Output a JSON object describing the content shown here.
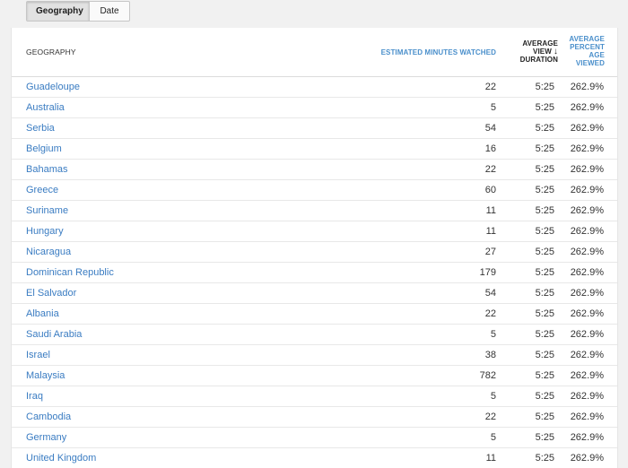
{
  "tabs": [
    {
      "label": "Geography",
      "active": true
    },
    {
      "label": "Date",
      "active": false
    }
  ],
  "table": {
    "headers": {
      "geography": "GEOGRAPHY",
      "estimated_minutes": "ESTIMATED MINUTES WATCHED",
      "avg_view_duration_line1": "AVERAGE",
      "avg_view_duration_line2": "VIEW",
      "avg_view_duration_line3": "DURATION",
      "sort_arrow": "↓",
      "avg_percent_line1": "AVERAGE",
      "avg_percent_line2": "PERCENT",
      "avg_percent_line3": "AGE",
      "avg_percent_line4": "VIEWED"
    },
    "rows": [
      {
        "geography": "Guadeloupe",
        "minutes": "22",
        "duration": "5:25",
        "percent": "262.9%"
      },
      {
        "geography": "Australia",
        "minutes": "5",
        "duration": "5:25",
        "percent": "262.9%"
      },
      {
        "geography": "Serbia",
        "minutes": "54",
        "duration": "5:25",
        "percent": "262.9%"
      },
      {
        "geography": "Belgium",
        "minutes": "16",
        "duration": "5:25",
        "percent": "262.9%"
      },
      {
        "geography": "Bahamas",
        "minutes": "22",
        "duration": "5:25",
        "percent": "262.9%"
      },
      {
        "geography": "Greece",
        "minutes": "60",
        "duration": "5:25",
        "percent": "262.9%"
      },
      {
        "geography": "Suriname",
        "minutes": "11",
        "duration": "5:25",
        "percent": "262.9%"
      },
      {
        "geography": "Hungary",
        "minutes": "11",
        "duration": "5:25",
        "percent": "262.9%"
      },
      {
        "geography": "Nicaragua",
        "minutes": "27",
        "duration": "5:25",
        "percent": "262.9%"
      },
      {
        "geography": "Dominican Republic",
        "minutes": "179",
        "duration": "5:25",
        "percent": "262.9%"
      },
      {
        "geography": "El Salvador",
        "minutes": "54",
        "duration": "5:25",
        "percent": "262.9%"
      },
      {
        "geography": "Albania",
        "minutes": "22",
        "duration": "5:25",
        "percent": "262.9%"
      },
      {
        "geography": "Saudi Arabia",
        "minutes": "5",
        "duration": "5:25",
        "percent": "262.9%"
      },
      {
        "geography": "Israel",
        "minutes": "38",
        "duration": "5:25",
        "percent": "262.9%"
      },
      {
        "geography": "Malaysia",
        "minutes": "782",
        "duration": "5:25",
        "percent": "262.9%"
      },
      {
        "geography": "Iraq",
        "minutes": "5",
        "duration": "5:25",
        "percent": "262.9%"
      },
      {
        "geography": "Cambodia",
        "minutes": "22",
        "duration": "5:25",
        "percent": "262.9%"
      },
      {
        "geography": "Germany",
        "minutes": "5",
        "duration": "5:25",
        "percent": "262.9%"
      },
      {
        "geography": "United Kingdom",
        "minutes": "11",
        "duration": "5:25",
        "percent": "262.9%"
      }
    ]
  },
  "colors": {
    "link": "#3a7cc2",
    "sortable_header": "#4a8fcb",
    "background": "#f1f1f1"
  }
}
